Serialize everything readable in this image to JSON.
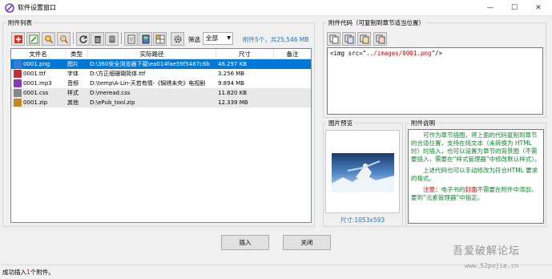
{
  "window": {
    "title": "软件设置窗口",
    "min_glyph": "—",
    "max_glyph": "☐",
    "close_glyph": "✕"
  },
  "list_group": {
    "title": "附件列表"
  },
  "toolbar": {
    "filter_label": "筛选",
    "filter_value": "全部",
    "count_summary": "附件5个，共25,546 MB"
  },
  "columns": [
    "文件名",
    "类型",
    "实际路径",
    "尺寸",
    "备注"
  ],
  "files": [
    {
      "name": "0001.png",
      "type": "图片",
      "path": "D:\\360安全浏览器下载\\ea014fae59f5487c6b",
      "size": "46.297 KB",
      "note": "",
      "icon": "image-file-icon",
      "color": "#3a7bd5"
    },
    {
      "name": "0001.ttf",
      "type": "字体",
      "path": "D:\\方正细珊瑚简体.ttf",
      "size": "3.256 MB",
      "note": "",
      "icon": "font-file-icon",
      "color": "#c03030"
    },
    {
      "name": "0001.mp3",
      "type": "音频",
      "path": "D:\\temp\\A-Lin-天若有情-《锦绣未央》电视剧",
      "size": "9.894 MB",
      "note": "",
      "icon": "audio-file-icon",
      "color": "#8a3ab9"
    },
    {
      "name": "0001.css",
      "type": "样式",
      "path": "D:\\meread.css",
      "size": "11.820 KB",
      "note": "",
      "icon": "css-file-icon",
      "color": "#888888"
    },
    {
      "name": "0001.zip",
      "type": "其他",
      "path": "D:\\ePub_tool.zip",
      "size": "12.339 MB",
      "note": "",
      "icon": "zip-file-icon",
      "color": "#c08a20"
    }
  ],
  "code_group": {
    "title": "附件代码（可复制到章节适当位置）"
  },
  "code": {
    "prefix": "<img src=\"",
    "path": "../images/0001.png",
    "suffix": "\"/>"
  },
  "preview_group": {
    "title": "图片预览",
    "size_text": "尺寸:1053x593"
  },
  "desc_group": {
    "title": "附件说明"
  },
  "description": {
    "p1": "可作为章节插图，将上面的代码复制到章节的合适位置，支持在纯文本（未转换为 HTML 时）时插入，也可以设置为章节的背景图（不需要插入，需要在“样式管理器”中修改默认样式）。",
    "p2": "上述代码也可以手动修改为符合HTML 要求的格式。",
    "p3_label": "注意：",
    "p3_a": "电子书的",
    "p3_b": "封面",
    "p3_c": "不需要在附件中添加，要到“元素管理器”中指定。"
  },
  "buttons": {
    "insert": "插入",
    "close": "关闭"
  },
  "status": {
    "prefix": "成功插入",
    "count": "1",
    "suffix": "个附件。"
  },
  "watermark": {
    "line1": "吾爱破解论坛",
    "line2": "www.52pojie.cn"
  }
}
